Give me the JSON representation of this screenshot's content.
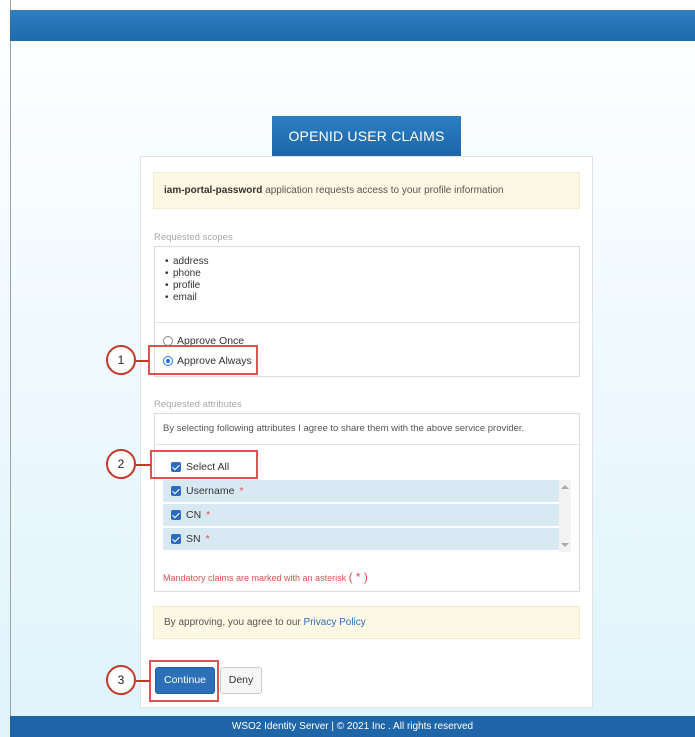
{
  "header": {
    "title": "OPENID USER CLAIMS"
  },
  "info": {
    "app_name": "iam-portal-password",
    "message": " application requests access to your profile information"
  },
  "scopes": {
    "label": "Requested scopes",
    "items": [
      "address",
      "phone",
      "profile",
      "email"
    ],
    "options": [
      {
        "label": "Approve Once",
        "checked": false
      },
      {
        "label": "Approve Always",
        "checked": true
      }
    ]
  },
  "attributes": {
    "label": "Requested attributes",
    "note": "By selecting following attributes I agree to share them with the above service provider.",
    "select_all": "Select All",
    "claims": [
      {
        "name": "Username",
        "required": "*"
      },
      {
        "name": "CN",
        "required": "*"
      },
      {
        "name": "SN",
        "required": "*"
      }
    ],
    "mandatory_text": "Mandatory claims are marked with an asterisk",
    "mandatory_symbol": "( * )"
  },
  "policy": {
    "text": "By approving, you agree to our ",
    "link": "Privacy Policy"
  },
  "buttons": {
    "continue": "Continue",
    "deny": "Deny"
  },
  "callouts": [
    "1",
    "2",
    "3"
  ],
  "footer": {
    "text": "WSO2 Identity Server | © 2021 Inc . All rights reserved"
  },
  "colors": {
    "primary": "#2d6fb8",
    "highlight": "#e05252",
    "warning_bg": "#fcf8e3"
  }
}
